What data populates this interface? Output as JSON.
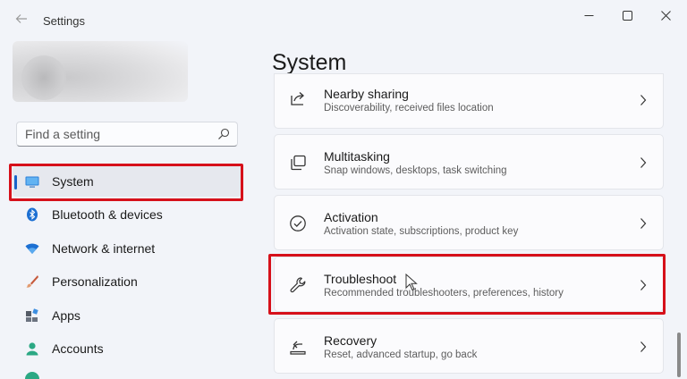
{
  "window": {
    "title": "Settings"
  },
  "search": {
    "placeholder": "Find a setting"
  },
  "sidebar": {
    "items": [
      {
        "label": "System",
        "icon": "monitor-icon",
        "selected": true
      },
      {
        "label": "Bluetooth & devices",
        "icon": "bluetooth-icon"
      },
      {
        "label": "Network & internet",
        "icon": "wifi-icon"
      },
      {
        "label": "Personalization",
        "icon": "brush-icon"
      },
      {
        "label": "Apps",
        "icon": "apps-icon"
      },
      {
        "label": "Accounts",
        "icon": "person-icon"
      }
    ]
  },
  "main": {
    "title": "System",
    "cards": [
      {
        "title": "Nearby sharing",
        "subtitle": "Discoverability, received files location",
        "icon": "share-icon"
      },
      {
        "title": "Multitasking",
        "subtitle": "Snap windows, desktops, task switching",
        "icon": "multitasking-icon"
      },
      {
        "title": "Activation",
        "subtitle": "Activation state, subscriptions, product key",
        "icon": "checkmark-circle-icon"
      },
      {
        "title": "Troubleshoot",
        "subtitle": "Recommended troubleshooters, preferences, history",
        "icon": "wrench-icon"
      },
      {
        "title": "Recovery",
        "subtitle": "Reset, advanced startup, go back",
        "icon": "recovery-icon"
      }
    ]
  },
  "colors": {
    "accent": "#1a64c8",
    "highlight": "#d6101a",
    "background": "#f2f4f9"
  }
}
